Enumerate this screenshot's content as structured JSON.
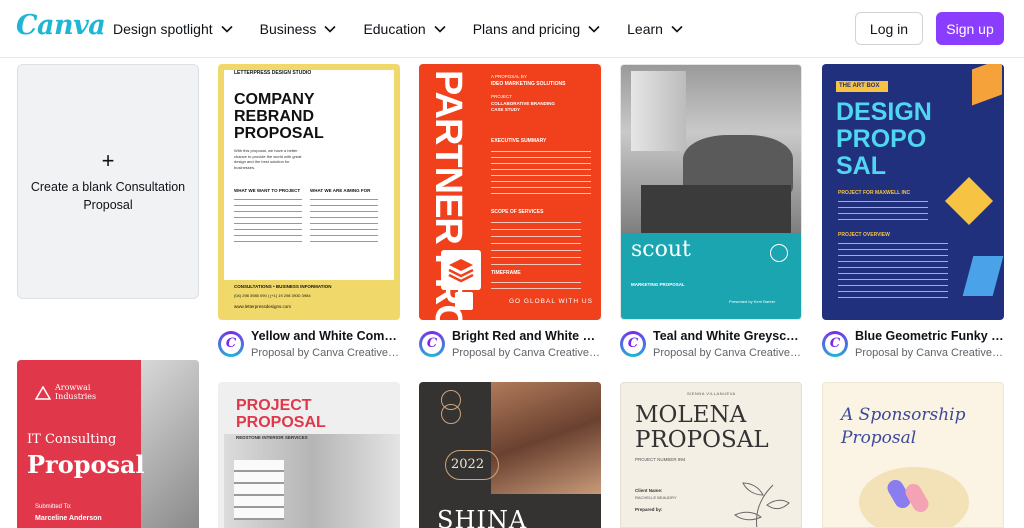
{
  "header": {
    "logo": "Canva",
    "nav": [
      {
        "label": "Design spotlight"
      },
      {
        "label": "Business"
      },
      {
        "label": "Education"
      },
      {
        "label": "Plans and pricing"
      },
      {
        "label": "Learn"
      }
    ],
    "login_label": "Log in",
    "signup_label": "Sign up"
  },
  "blank_card": {
    "plus": "+",
    "label": "Create a blank Consultation Proposal"
  },
  "templates": [
    {
      "title": "Yellow and White Compa...",
      "subtitle": "Proposal by Canva Creative S...",
      "thumb": {
        "studio": "LETTERPRESS DESIGN STUDIO",
        "h1": "COMPANY",
        "h2": "REBRAND",
        "h3": "PROPOSAL",
        "intro": "With this proposal, we have a better chance to provide the world with great design and the best solution for businesses.",
        "col1": "WHAT WE WANT TO PROJECT",
        "col2": "WHAT WE ARE AIMING FOR",
        "footer": "CONSULTATIONS • BUSINESS INFORMATION",
        "phone": "(04) 298 3985 090 | (+1) 19 298 3930 3984",
        "url": "www.letterpressdesigns.com"
      }
    },
    {
      "title": "Bright Red and White Sq...",
      "subtitle": "Proposal by Canva Creative S...",
      "thumb": {
        "vertical": "PARTNER PROPOSAL",
        "label": "A PROPOSAL BY",
        "company": "IDEO MARKETING SOLUTIONS",
        "project": "PROJECT",
        "project_name": "COLLABORATIVE BRANDING CASE STUDY",
        "summary": "EXECUTIVE SUMMARY",
        "scope": "SCOPE OF SERVICES",
        "timeframe": "TIMEFRAME",
        "go": "GO GLOBAL WITH US"
      }
    },
    {
      "title": "Teal and White Greyscale...",
      "subtitle": "Proposal by Canva Creative S...",
      "thumb": {
        "brand": "scout",
        "label": "MARKETING PROPOSAL",
        "byline": "Presented by Kerri Barber"
      }
    },
    {
      "title": "Blue Geometric Funky Pr...",
      "subtitle": "Proposal by Canva Creative S...",
      "thumb": {
        "tag": "THE ART BOX",
        "h1": "DESIGN",
        "h2": "PROPO",
        "h3": "SAL",
        "client": "PROJECT FOR MAXWELL INC",
        "overview": "PROJECT OVERVIEW"
      }
    },
    {
      "thumb": {
        "company": "Arowwai Industries",
        "h1": "IT Consulting",
        "h2": "Proposal",
        "submitted": "Submitted To:",
        "name": "Marceline Anderson"
      }
    },
    {
      "thumb": {
        "h1": "PROJECT",
        "h2": "PROPOSAL",
        "sub": "REDSTONE INTERIOR SERVICES"
      }
    },
    {
      "thumb": {
        "year": "2022",
        "name": "SHINA"
      }
    },
    {
      "thumb": {
        "name_top": "SIENNA VILLANUEVA",
        "h1": "MOLENA",
        "h2": "PROPOSAL",
        "num": "PROJECT NUMBER 894",
        "client": "Client Name:",
        "client_name": "RACHELLE BEAUDRY",
        "prepared": "Prepared by:"
      }
    },
    {
      "thumb": {
        "h1": "A Sponsorship",
        "h2": "Proposal"
      }
    }
  ],
  "colors": {
    "brand": "#8b3dff",
    "logo": "#1fb6d6",
    "yellow": "#f1d86a",
    "red": "#f0411c",
    "teal": "#1aa5b0",
    "navy": "#21307d",
    "crimson": "#e0374a"
  }
}
